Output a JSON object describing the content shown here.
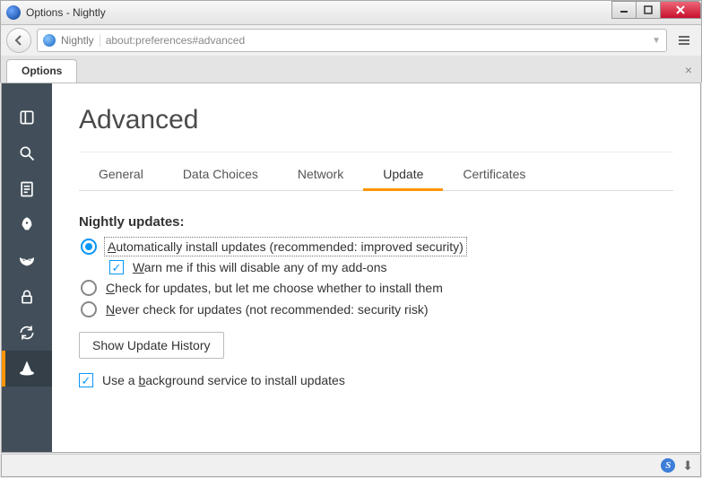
{
  "window": {
    "title": "Options - Nightly"
  },
  "toolbar": {
    "identity": "Nightly",
    "url": "about:preferences#advanced"
  },
  "page_tab": {
    "label": "Options"
  },
  "sidebar": {
    "items": [
      {
        "name": "general",
        "active": false
      },
      {
        "name": "search",
        "active": false
      },
      {
        "name": "content",
        "active": false
      },
      {
        "name": "applications",
        "active": false
      },
      {
        "name": "privacy",
        "active": false
      },
      {
        "name": "security",
        "active": false
      },
      {
        "name": "sync",
        "active": false
      },
      {
        "name": "advanced",
        "active": true
      }
    ]
  },
  "main": {
    "title": "Advanced",
    "tabs": [
      {
        "label": "General",
        "active": false
      },
      {
        "label": "Data Choices",
        "active": false
      },
      {
        "label": "Network",
        "active": false
      },
      {
        "label": "Update",
        "active": true
      },
      {
        "label": "Certificates",
        "active": false
      }
    ],
    "update": {
      "section_heading": "Nightly updates:",
      "radios": [
        {
          "label_pre": "A",
          "label_rest": "utomatically install updates (recommended: improved security)",
          "checked": true,
          "focused": true
        },
        {
          "label_pre": "C",
          "label_rest": "heck for updates, but let me choose whether to install them",
          "checked": false,
          "focused": false
        },
        {
          "label_pre": "N",
          "label_rest": "ever check for updates (not recommended: security risk)",
          "checked": false,
          "focused": false
        }
      ],
      "warn_checkbox": {
        "label_pre": "W",
        "label_rest": "arn me if this will disable any of my add-ons",
        "checked": true
      },
      "history_button": "Show Update History",
      "background_checkbox": {
        "label_pre": "b",
        "label_preword": "Use a ",
        "label_rest": "ackground service to install updates",
        "checked": true
      }
    }
  },
  "status": {
    "indicator": "S"
  }
}
